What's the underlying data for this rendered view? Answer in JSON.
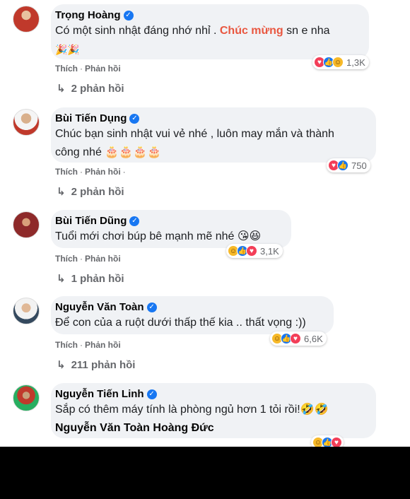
{
  "comments": [
    {
      "name": "Trọng Hoàng",
      "text_parts": [
        "Có một sinh nhật đáng nhớ nhỉ . ",
        "Chúc mừng",
        " sn e nha"
      ],
      "line2": "🎉🎉",
      "reaction_count": "1,3K",
      "like": "Thích",
      "reply": "Phản hồi",
      "replies": "2 phản hồi",
      "avatar_color": "#c0392b"
    },
    {
      "name": "Bùi Tiến Dụng",
      "text_parts": [
        "Chúc bạn sinh nhật vui vẻ nhé , luôn may mắn và thành"
      ],
      "line2": "công nhé 🎂🎂🎂🎂",
      "reaction_count": "750",
      "like": "Thích",
      "reply": "Phản hồi",
      "replies": "2 phản hồi",
      "avatar_color": "#7f8c8d"
    },
    {
      "name": "Bùi Tiến Dũng",
      "text_parts": [
        "Tuổi mới chơi búp bê mạnh mẽ nhé 😘😆"
      ],
      "reaction_count": "3,1K",
      "like": "Thích",
      "reply": "Phản hồi",
      "replies": "1 phản hồi",
      "avatar_color": "#8e2a2a"
    },
    {
      "name": "Nguyễn Văn Toàn",
      "text_parts": [
        "Để con của a ruột dưới thấp thế kia .. thất vọng :))"
      ],
      "reaction_count": "6,6K",
      "like": "Thích",
      "reply": "Phản hồi",
      "replies": "211 phản hồi",
      "avatar_color": "#34495e"
    },
    {
      "name": "Nguyễn Tiến Linh",
      "text_parts": [
        "Sắp có thêm máy tính là phòng ngủ hơn 1 tỏi rồi!🤣🤣"
      ],
      "tag": "Nguyễn Văn Toàn Hoàng Đức",
      "avatar_color": "#27ae60"
    }
  ],
  "colors": {
    "highlight": "#e9563f",
    "bubble": "#f0f2f5",
    "meta": "#65676b",
    "verified": "#1877f2"
  }
}
